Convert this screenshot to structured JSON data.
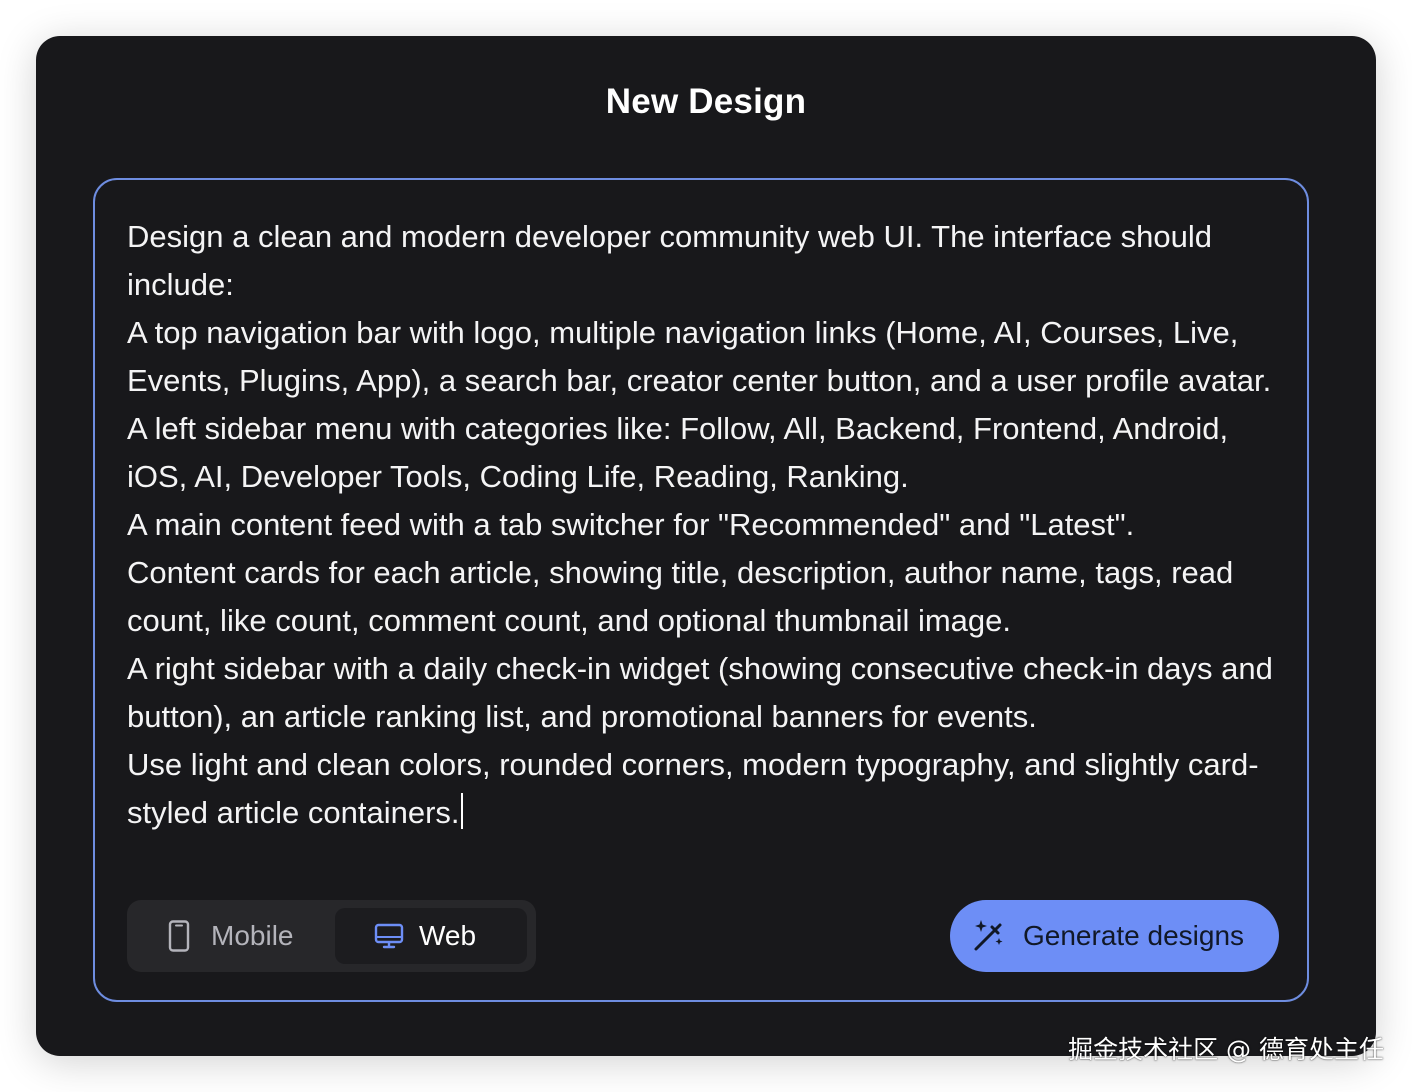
{
  "dialog": {
    "title": "New Design"
  },
  "prompt": {
    "text": "Design a clean and modern developer community web UI. The interface should include:\nA top navigation bar with logo, multiple navigation links (Home, AI, Courses, Live, Events, Plugins, App), a search bar, creator center button, and a user profile avatar.\nA left sidebar menu with categories like: Follow, All, Backend, Frontend, Android, iOS, AI, Developer Tools, Coding Life, Reading, Ranking.\nA main content feed with a tab switcher for \"Recommended\" and \"Latest\".\nContent cards for each article, showing title, description, author name, tags, read count, like count, comment count, and optional thumbnail image.\nA right sidebar with a daily check-in widget (showing consecutive check-in days and button), an article ranking list, and promotional banners for events.\nUse light and clean colors, rounded corners, modern typography, and slightly card-styled article containers."
  },
  "device_toggle": {
    "options": [
      {
        "label": "Mobile",
        "icon": "mobile-phone-icon",
        "selected": false
      },
      {
        "label": "Web",
        "icon": "desktop-monitor-icon",
        "selected": true
      }
    ]
  },
  "generate_button": {
    "label": "Generate designs",
    "icon": "magic-wand-icon"
  },
  "watermark": {
    "text": "掘金技术社区 @ 德育处主任"
  },
  "colors": {
    "dialog_bg": "#18181b",
    "accent": "#6d8ef6",
    "border": "#6e8de0",
    "toggle_bg": "#27272a"
  }
}
